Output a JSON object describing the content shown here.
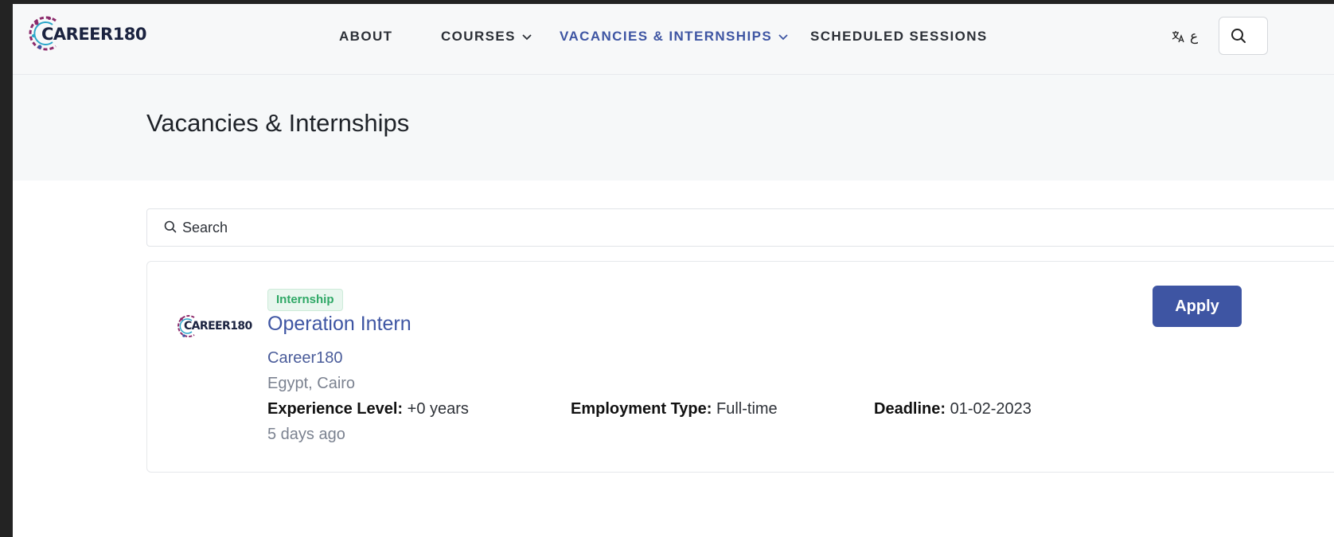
{
  "brand": {
    "logo_text": "CAREER180",
    "accent": "#3e55a3",
    "logo_ring_color": "#8b2a6b"
  },
  "nav": {
    "items": [
      {
        "label": "ABOUT",
        "has_dropdown": false,
        "active": false
      },
      {
        "label": "COURSES",
        "has_dropdown": true,
        "active": false
      },
      {
        "label": "VACANCIES & INTERNSHIPS",
        "has_dropdown": true,
        "active": true
      },
      {
        "label": "SCHEDULED SESSIONS",
        "has_dropdown": false,
        "active": false
      }
    ],
    "language_label": "ع",
    "language_icon": "translate-icon",
    "search_icon": "search-icon"
  },
  "page": {
    "title": "Vacancies & Internships"
  },
  "search": {
    "placeholder": "Search",
    "icon": "search-icon"
  },
  "listings": [
    {
      "badge": "Internship",
      "badge_color": "#2fa866",
      "title": "Operation Intern",
      "company": "Career180",
      "company_logo_text": "CAREER180",
      "location": "Egypt, Cairo",
      "experience_label": "Experience Level:",
      "experience_value": "+0 years",
      "employment_label": "Employment Type:",
      "employment_value": "Full-time",
      "deadline_label": "Deadline:",
      "deadline_value": "01-02-2023",
      "posted": "5 days ago",
      "apply_label": "Apply"
    }
  ]
}
